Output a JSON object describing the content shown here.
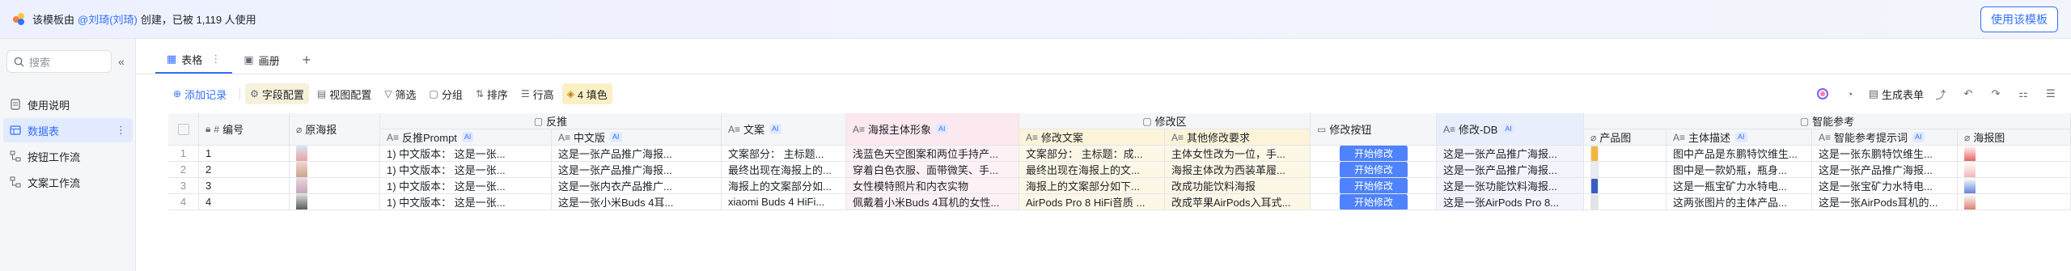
{
  "banner": {
    "prefix": "该模板由",
    "author": "@刘琦(刘琦)",
    "suffix": "创建，已被 1,119 人使用",
    "use_button": "使用该模板"
  },
  "sidebar": {
    "search_placeholder": "搜索",
    "items": [
      {
        "label": "使用说明",
        "icon": "doc-icon"
      },
      {
        "label": "数据表",
        "icon": "table-icon",
        "active": true
      },
      {
        "label": "按钮工作流",
        "icon": "workflow-icon"
      },
      {
        "label": "文案工作流",
        "icon": "workflow-icon"
      }
    ]
  },
  "tabs": [
    {
      "label": "表格",
      "icon": "table-icon"
    },
    {
      "label": "画册",
      "icon": "gallery-icon"
    }
  ],
  "toolbar": {
    "add": "添加记录",
    "field_config": "字段配置",
    "view_config": "视图配置",
    "filter": "筛选",
    "group": "分组",
    "sort": "排序",
    "row_height": "行高",
    "fill": "4 填色",
    "generate_form": "生成表单"
  },
  "columns": {
    "groups": {
      "reverse": "反推",
      "modify_area": "修改区",
      "smart_ref": "智能参考"
    },
    "id": "编号",
    "original_poster": "原海报",
    "reverse_prompt": "反推Prompt",
    "chinese_version": "中文版",
    "copy": "文案",
    "poster_subject": "海报主体形象",
    "modify_copy": "修改文案",
    "other_requirements": "其他修改要求",
    "modify_button": "修改按钮",
    "modify_db": "修改-DB",
    "product_image": "产品图",
    "subject_desc": "主体描述",
    "smart_ref_prompt": "智能参考提示词",
    "poster_image": "海报图"
  },
  "ai_badge": "AI",
  "rows": [
    {
      "no": "1",
      "id": "1",
      "reverse_prompt": "1) 中文版本： 这是一张...",
      "chinese_version": "这是一张产品推广海报...",
      "copy": "文案部分： 主标题...",
      "poster_subject": "浅蓝色天空图案和两位手持产...",
      "modify_copy": "文案部分： 主标题：成...",
      "other_requirements": "主体女性改为一位，手...",
      "modify_button": "开始修改",
      "modify_db": "这是一张产品推广海报...",
      "subject_desc": "图中产品是东鹏特饮维生...",
      "smart_ref_prompt": "这是一张东鹏特饮维生..."
    },
    {
      "no": "2",
      "id": "2",
      "reverse_prompt": "1) 中文版本： 这是一张...",
      "chinese_version": "这是一张产品推广海报...",
      "copy": "最终出现在海报上的...",
      "poster_subject": "穿着白色衣服、面带微笑、手...",
      "modify_copy": "最终出现在海报上的文...",
      "other_requirements": "海报主体改为西装革履...",
      "modify_button": "开始修改",
      "modify_db": "这是一张产品推广海报...",
      "subject_desc": "图中是一款奶瓶，瓶身...",
      "smart_ref_prompt": "这是一张产品推广海报..."
    },
    {
      "no": "3",
      "id": "3",
      "reverse_prompt": "1) 中文版本： 这是一张...",
      "chinese_version": "这是一张内衣产品推广...",
      "copy": "海报上的文案部分如...",
      "poster_subject": "女性模特照片和内衣实物",
      "modify_copy": "海报上的文案部分如下...",
      "other_requirements": "改成功能饮料海报",
      "modify_button": "开始修改",
      "modify_db": "这是一张功能饮料海报...",
      "subject_desc": "这是一瓶宝矿力水特电...",
      "smart_ref_prompt": "这是一张宝矿力水特电..."
    },
    {
      "no": "4",
      "id": "4",
      "reverse_prompt": "1) 中文版本： 这是一张...",
      "chinese_version": "这是一张小米Buds 4耳...",
      "copy": "xiaomi Buds 4 HiFi...",
      "poster_subject": "佩戴着小米Buds 4耳机的女性...",
      "modify_copy": "AirPods Pro 8 HiFi音质 ...",
      "other_requirements": "改成苹果AirPods入耳式...",
      "modify_button": "开始修改",
      "modify_db": "这是一张AirPods Pro 8...",
      "subject_desc": "这两张图片的主体产品...",
      "smart_ref_prompt": "这是一张AirPods耳机的..."
    }
  ],
  "colors": {
    "accent": "#3370ff",
    "pink_column": "#fce8ef",
    "yellow_column": "#fcf3d8",
    "blue_column": "#e8eefb",
    "button": "#4e83fd"
  }
}
